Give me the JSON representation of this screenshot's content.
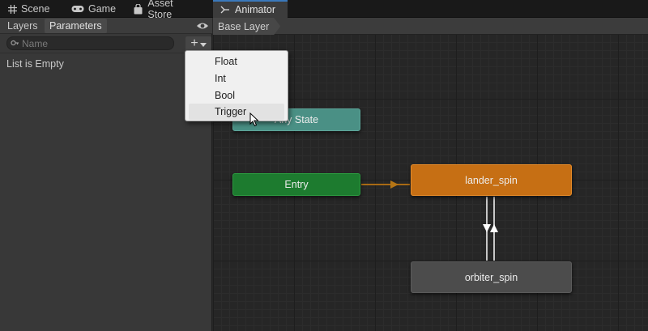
{
  "tabs": [
    {
      "label": "Scene",
      "icon": "grid-icon"
    },
    {
      "label": "Game",
      "icon": "gamepad-icon"
    },
    {
      "label": "Asset Store",
      "icon": "bag-icon"
    },
    {
      "label": "Animator",
      "icon": "animator-icon"
    }
  ],
  "active_tab": "Animator",
  "left_panel": {
    "subtabs": [
      "Layers",
      "Parameters"
    ],
    "selected_subtab": "Parameters",
    "search_placeholder": "Name",
    "add_button": "+",
    "empty_text": "List is Empty"
  },
  "breadcrumb": "Base Layer",
  "nodes": {
    "any_state": "Any State",
    "entry": "Entry",
    "lander_spin": "lander_spin",
    "orbiter_spin": "orbiter_spin"
  },
  "dropdown": {
    "items": [
      "Float",
      "Int",
      "Bool",
      "Trigger"
    ],
    "hovered": "Trigger"
  },
  "colors": {
    "accent": "#3a79bb",
    "any_state": "#4a9085",
    "entry": "#1d7b2f",
    "default_state": "#c66f14",
    "state": "#4c4c4c",
    "transition_entry": "#a86a14"
  }
}
